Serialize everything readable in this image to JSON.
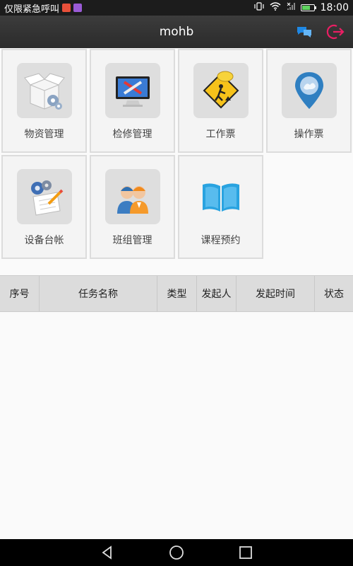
{
  "status_bar": {
    "carrier_text": "仅限紧急呼叫",
    "time": "18:00",
    "battery_level": 0.7
  },
  "header": {
    "title": "mohb"
  },
  "tiles": [
    {
      "label": "物资管理",
      "icon": "open-box-gears-icon"
    },
    {
      "label": "检修管理",
      "icon": "monitor-tools-icon"
    },
    {
      "label": "工作票",
      "icon": "construction-sign-icon"
    },
    {
      "label": "操作票",
      "icon": "map-pin-icon"
    },
    {
      "label": "设备台帐",
      "icon": "gears-document-icon"
    },
    {
      "label": "班组管理",
      "icon": "workers-team-icon"
    },
    {
      "label": "课程预约",
      "icon": "open-book-icon"
    }
  ],
  "table": {
    "columns": [
      "序号",
      "任务名称",
      "类型",
      "发起人",
      "发起时间",
      "状态"
    ]
  },
  "colors": {
    "header_bg": "#333333",
    "chat_icon": "#1e88e5",
    "logout_icon": "#e91e63",
    "book_icon": "#29a3e0"
  }
}
